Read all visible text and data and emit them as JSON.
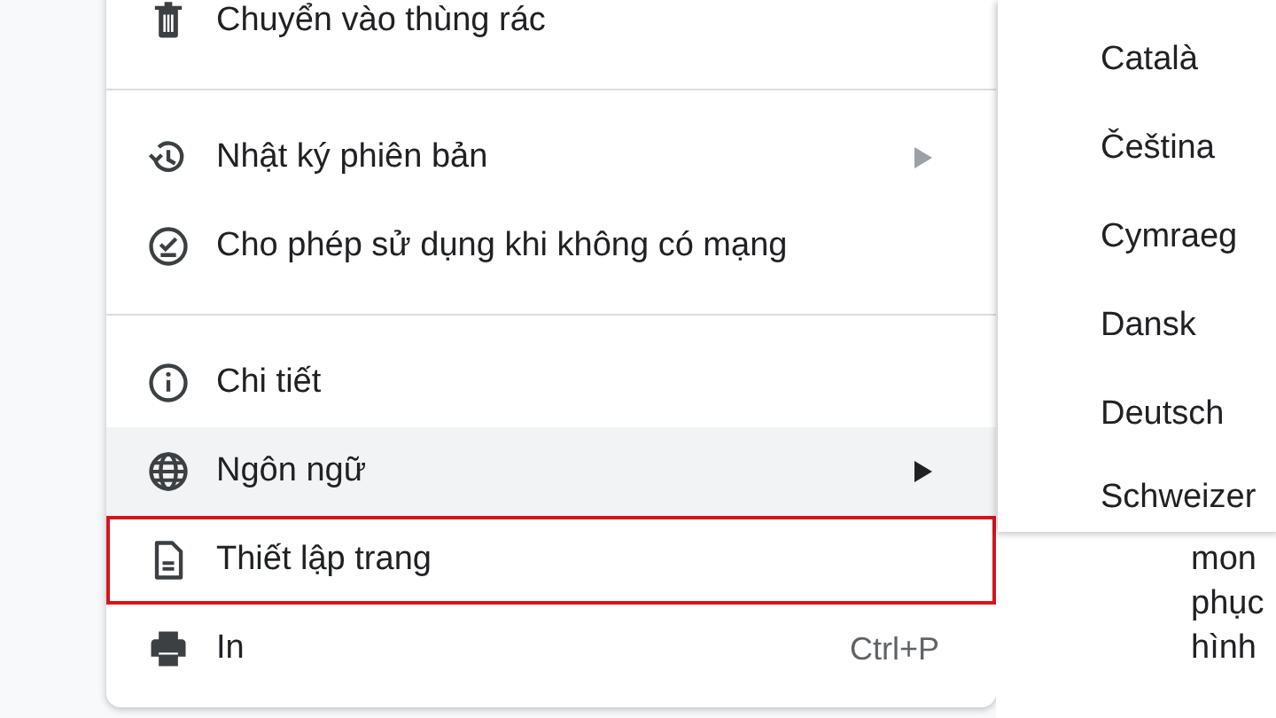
{
  "menu": {
    "sections": [
      {
        "items": [
          {
            "kind": "trash",
            "label": "Chuyển vào thùng rác",
            "submenu": false,
            "hovered": false,
            "highlighted": false
          }
        ]
      },
      {
        "items": [
          {
            "kind": "history",
            "label": "Nhật ký phiên bản",
            "submenu": true,
            "hovered": false,
            "highlighted": false
          },
          {
            "kind": "offline",
            "label": "Cho phép sử dụng khi không có mạng",
            "submenu": false,
            "hovered": false,
            "highlighted": false
          }
        ]
      },
      {
        "items": [
          {
            "kind": "info",
            "label": "Chi tiết",
            "submenu": false,
            "hovered": false,
            "highlighted": false
          },
          {
            "kind": "globe",
            "label": "Ngôn ngữ",
            "submenu": true,
            "hovered": true,
            "highlighted": false
          },
          {
            "kind": "page",
            "label": "Thiết lập trang",
            "submenu": false,
            "hovered": false,
            "highlighted": true
          },
          {
            "kind": "print",
            "label": "In",
            "shortcut": "Ctrl+P",
            "submenu": false,
            "hovered": false,
            "highlighted": false
          }
        ]
      }
    ]
  },
  "language_submenu": {
    "items": [
      "Català",
      "Čeština",
      "Cymraeg",
      "Dansk",
      "Deutsch",
      "Schweizer"
    ]
  },
  "document": {
    "lines": [
      "mon",
      "phục",
      "hình"
    ]
  }
}
